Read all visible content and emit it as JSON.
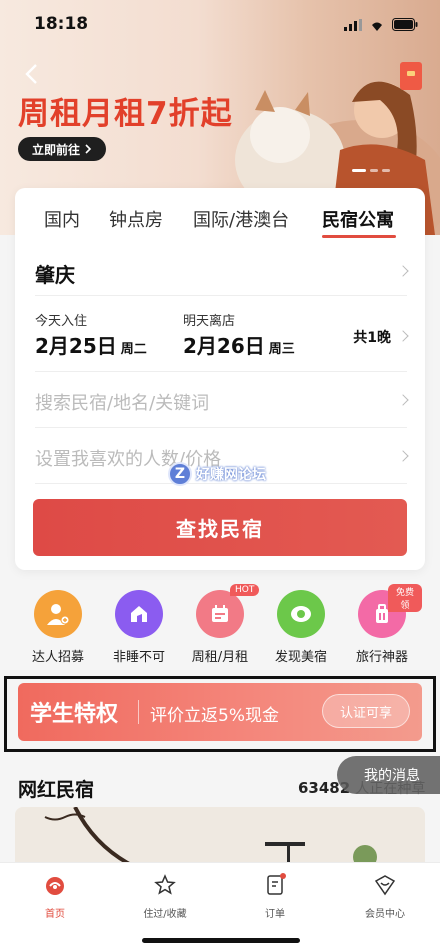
{
  "status": {
    "time": "18:18"
  },
  "banner": {
    "title": "周租月租7折起",
    "button_label": "立即前往"
  },
  "tabs": [
    "国内",
    "钟点房",
    "国际/港澳台",
    "民宿公寓"
  ],
  "booking": {
    "city": "肇庆",
    "checkin_label": "今天入住",
    "checkin_date": "2月25日",
    "checkin_weekday": "周二",
    "checkout_label": "明天离店",
    "checkout_date": "2月26日",
    "checkout_weekday": "周三",
    "nights": "共1晚",
    "search_placeholder": "搜索民宿/地名/关键词",
    "people_placeholder": "设置我喜欢的人数/价格",
    "find_button": "查找民宿"
  },
  "watermark": {
    "badge": "Z",
    "text": "好赚网论坛"
  },
  "quick_icons": [
    {
      "label": "达人招募",
      "color": "#f5a23a",
      "icon": "person-add-icon"
    },
    {
      "label": "非睡不可",
      "color": "#8b5cf0",
      "icon": "house-icon"
    },
    {
      "label": "周租/月租",
      "color": "#f27a86",
      "icon": "calendar-icon",
      "badge": "HOT"
    },
    {
      "label": "发现美宿",
      "color": "#6cc84a",
      "icon": "eye-icon"
    },
    {
      "label": "旅行神器",
      "color": "#f36aa6",
      "icon": "suitcase-icon",
      "badge": "免费领"
    }
  ],
  "student": {
    "title": "学生特权",
    "desc": "评价立返5%现金",
    "button": "认证可享"
  },
  "section": {
    "title": "网红民宿",
    "count": "63482",
    "count_suffix": "人正在种草"
  },
  "message_pill": "我的消息",
  "tabbar": [
    {
      "label": "首页",
      "icon": "home-icon",
      "active": true
    },
    {
      "label": "住过/收藏",
      "icon": "star-icon",
      "active": false
    },
    {
      "label": "订单",
      "icon": "order-icon",
      "active": false
    },
    {
      "label": "会员中心",
      "icon": "member-icon",
      "active": false
    }
  ]
}
